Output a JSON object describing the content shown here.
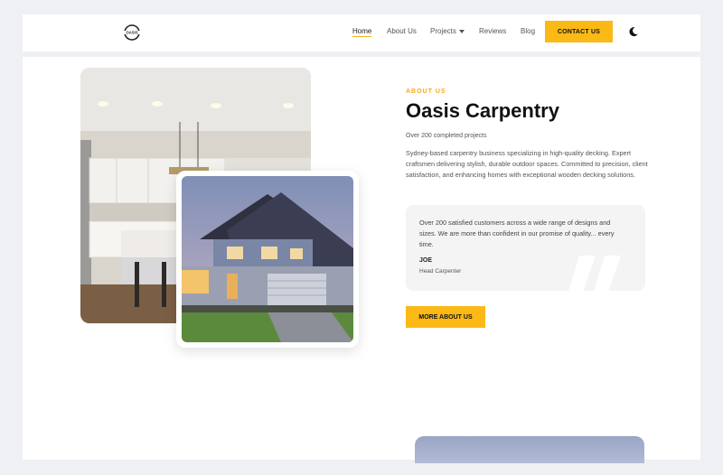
{
  "header": {
    "logo_text": "OASIS",
    "nav": [
      {
        "label": "Home",
        "active": true
      },
      {
        "label": "About Us",
        "active": false
      },
      {
        "label": "Projects",
        "active": false,
        "dropdown": true
      },
      {
        "label": "Reviews",
        "active": false
      },
      {
        "label": "Blog",
        "active": false
      }
    ],
    "contact_label": "CONTACT US",
    "theme_icon": "moon-icon"
  },
  "about": {
    "eyebrow": "ABOUT US",
    "title": "Oasis Carpentry",
    "subtitle": "Over 200 completed projects",
    "description": "Sydney-based carpentry business specializing in high-quality decking. Expert craftsmen delivering stylish, durable outdoor spaces. Committed to precision, client satisfaction, and enhancing homes with exceptional wooden decking solutions.",
    "testimonial": {
      "text": "Over 200 satisfied customers across a wide range of designs and sizes. We are more than confident in our promise of quality... every time.",
      "name": "JOE",
      "role": "Head Carpenter"
    },
    "button_label": "MORE ABOUT US"
  },
  "colors": {
    "accent": "#fbb916",
    "background": "#eef0f3"
  }
}
